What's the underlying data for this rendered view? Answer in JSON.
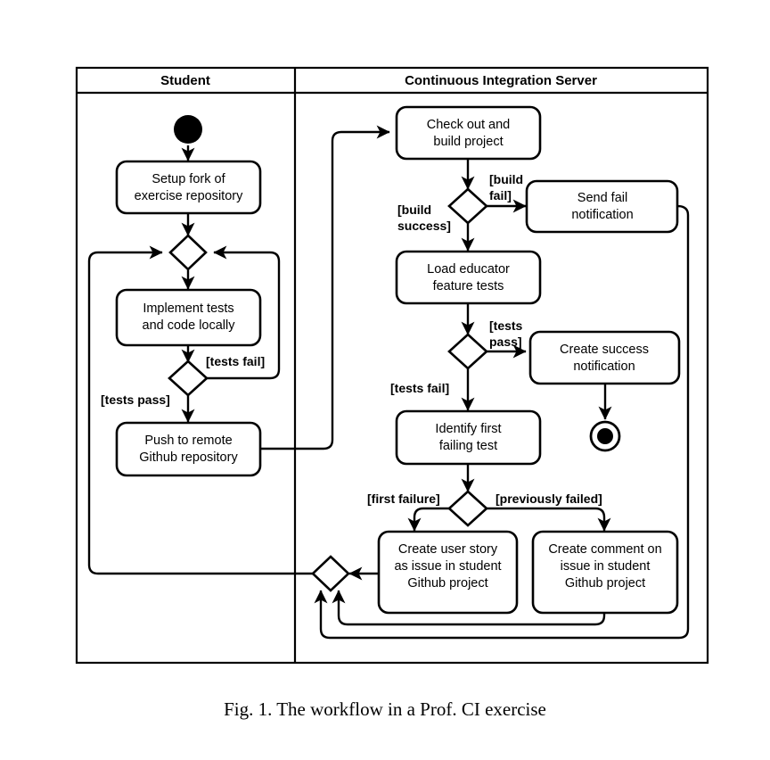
{
  "figure": {
    "caption": "Fig. 1.  The workflow in a Prof. CI exercise"
  },
  "diagram": {
    "type": "uml-activity-diagram",
    "colors": {
      "stroke": "#000000",
      "fill": "#ffffff",
      "background": "#ffffff"
    },
    "lanes": [
      {
        "id": "student",
        "title": "Student"
      },
      {
        "id": "ci-server",
        "title": "Continuous Integration Server"
      }
    ],
    "nodes": {
      "start": {
        "kind": "initial",
        "lane": "student"
      },
      "setup_fork": {
        "kind": "action",
        "lane": "student",
        "line1": "Setup fork of",
        "line2": "exercise repository"
      },
      "merge_student": {
        "kind": "merge",
        "lane": "student"
      },
      "implement": {
        "kind": "action",
        "lane": "student",
        "line1": "Implement tests",
        "line2": "and code locally"
      },
      "local_tests": {
        "kind": "decision",
        "lane": "student"
      },
      "push": {
        "kind": "action",
        "lane": "student",
        "line1": "Push to remote",
        "line2": "Github repository"
      },
      "checkout": {
        "kind": "action",
        "lane": "ci-server",
        "line1": "Check out and",
        "line2": "build project"
      },
      "build_decision": {
        "kind": "decision",
        "lane": "ci-server"
      },
      "send_fail": {
        "kind": "action",
        "lane": "ci-server",
        "line1": "Send fail",
        "line2": "notification"
      },
      "load_tests": {
        "kind": "action",
        "lane": "ci-server",
        "line1": "Load educator",
        "line2": "feature tests"
      },
      "tests_decision": {
        "kind": "decision",
        "lane": "ci-server"
      },
      "create_success": {
        "kind": "action",
        "lane": "ci-server",
        "line1": "Create success",
        "line2": "notification"
      },
      "identify_fail": {
        "kind": "action",
        "lane": "ci-server",
        "line1": "Identify first",
        "line2": "failing test"
      },
      "failure_decision": {
        "kind": "decision",
        "lane": "ci-server"
      },
      "create_story": {
        "kind": "action",
        "lane": "ci-server",
        "line1": "Create user story",
        "line2": "as issue in student",
        "line3": "Github project"
      },
      "create_comment": {
        "kind": "action",
        "lane": "ci-server",
        "line1": "Create comment on",
        "line2": "issue in student",
        "line3": "Github project"
      },
      "merge_ci": {
        "kind": "merge",
        "lane": "ci-server"
      },
      "final": {
        "kind": "final",
        "lane": "ci-server"
      }
    },
    "guards": {
      "tests_fail_local": "[tests fail]",
      "tests_pass_local": "[tests pass]",
      "build_fail_1": "[build",
      "build_fail_2": "fail]",
      "build_success_1": "[build",
      "build_success_2": "success]",
      "tests_pass_ci_1": "[tests",
      "tests_pass_ci_2": "pass]",
      "tests_fail_ci": "[tests fail]",
      "first_failure": "[first failure]",
      "previously_failed": "[previously failed]"
    }
  }
}
